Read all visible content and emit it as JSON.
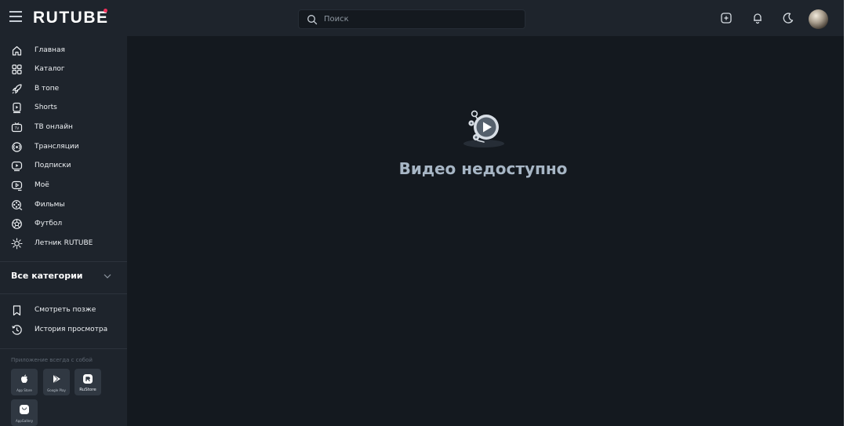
{
  "header": {
    "logo_text": "RUTUBE",
    "search_placeholder": "Поиск",
    "icons": [
      "menu-icon",
      "upload-icon",
      "bell-icon",
      "moon-icon"
    ]
  },
  "sidebar": {
    "items": [
      {
        "label": "Главная",
        "icon": "home-icon"
      },
      {
        "label": "Каталог",
        "icon": "catalog-icon"
      },
      {
        "label": "В топе",
        "icon": "rocket-icon"
      },
      {
        "label": "Shorts",
        "icon": "shorts-icon"
      },
      {
        "label": "ТВ онлайн",
        "icon": "tv-icon"
      },
      {
        "label": "Трансляции",
        "icon": "broadcast-icon"
      },
      {
        "label": "Подписки",
        "icon": "subscriptions-icon"
      },
      {
        "label": "Моё",
        "icon": "my-icon"
      },
      {
        "label": "Фильмы",
        "icon": "films-icon"
      },
      {
        "label": "Футбол",
        "icon": "football-icon"
      },
      {
        "label": "Летник RUTUBE",
        "icon": "sun-icon"
      }
    ],
    "categories_label": "Все категории",
    "library": [
      {
        "label": "Смотреть позже",
        "icon": "bookmark-icon"
      },
      {
        "label": "История просмотра",
        "icon": "history-icon"
      }
    ],
    "apps_title": "Приложение всегда с собой",
    "apps": [
      {
        "label": "App Store",
        "icon": "apple-icon"
      },
      {
        "label": "Google Play",
        "icon": "google-play-icon"
      },
      {
        "label": "RuStore",
        "icon": "rustore-icon"
      },
      {
        "label": "AppGallery",
        "icon": "appgallery-icon"
      }
    ]
  },
  "main": {
    "message": "Видео недоступно"
  },
  "colors": {
    "background": "#14191f",
    "panel": "#1e242c",
    "brand_dot": "#f0315b",
    "message": "#a7b6c5"
  }
}
